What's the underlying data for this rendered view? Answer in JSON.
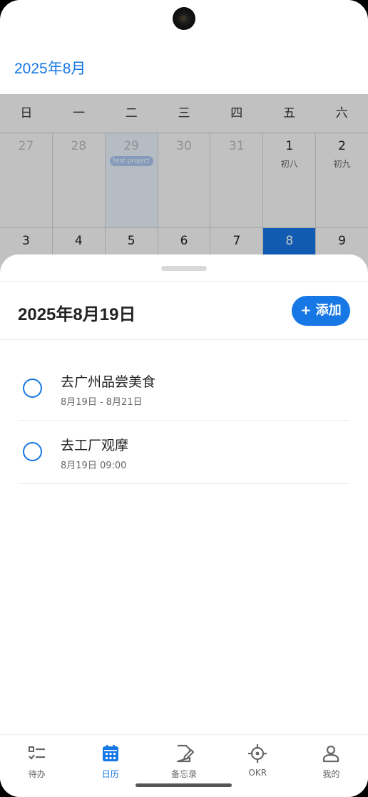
{
  "header": {
    "month_title": "2025年8月"
  },
  "calendar": {
    "weekdays": [
      "日",
      "一",
      "二",
      "三",
      "四",
      "五",
      "六"
    ],
    "weeks": [
      [
        {
          "day": "27",
          "lunar": "",
          "muted": true
        },
        {
          "day": "28",
          "lunar": "",
          "muted": true
        },
        {
          "day": "29",
          "lunar": "",
          "muted": true,
          "chip": "test project"
        },
        {
          "day": "30",
          "lunar": "",
          "muted": true
        },
        {
          "day": "31",
          "lunar": "",
          "muted": true
        },
        {
          "day": "1",
          "lunar": "初八",
          "muted": false
        },
        {
          "day": "2",
          "lunar": "初九",
          "muted": false
        }
      ],
      [
        {
          "day": "3",
          "lunar": "",
          "muted": false
        },
        {
          "day": "4",
          "lunar": "",
          "muted": false
        },
        {
          "day": "5",
          "lunar": "",
          "muted": false
        },
        {
          "day": "6",
          "lunar": "",
          "muted": false
        },
        {
          "day": "7",
          "lunar": "",
          "muted": false
        },
        {
          "day": "8",
          "lunar": "",
          "muted": false,
          "today": true
        },
        {
          "day": "9",
          "lunar": "",
          "muted": false
        }
      ]
    ]
  },
  "sheet": {
    "date_title": "2025年8月19日",
    "add_label": "+ 添加",
    "tasks": [
      {
        "title": "去广州品尝美食",
        "time": "8月19日 - 8月21日"
      },
      {
        "title": "去工厂观摩",
        "time": "8月19日 09:00"
      }
    ]
  },
  "tabbar": {
    "tabs": [
      {
        "label": "待办",
        "icon": "todo-list-icon",
        "active": false
      },
      {
        "label": "日历",
        "icon": "calendar-icon",
        "active": true
      },
      {
        "label": "备忘录",
        "icon": "memo-edit-icon",
        "active": false
      },
      {
        "label": "OKR",
        "icon": "target-crosshair-icon",
        "active": false
      },
      {
        "label": "我的",
        "icon": "person-icon",
        "active": false
      }
    ]
  },
  "colors": {
    "accent": "#1677e5",
    "text": "#222222",
    "muted": "#bbbbbb"
  }
}
